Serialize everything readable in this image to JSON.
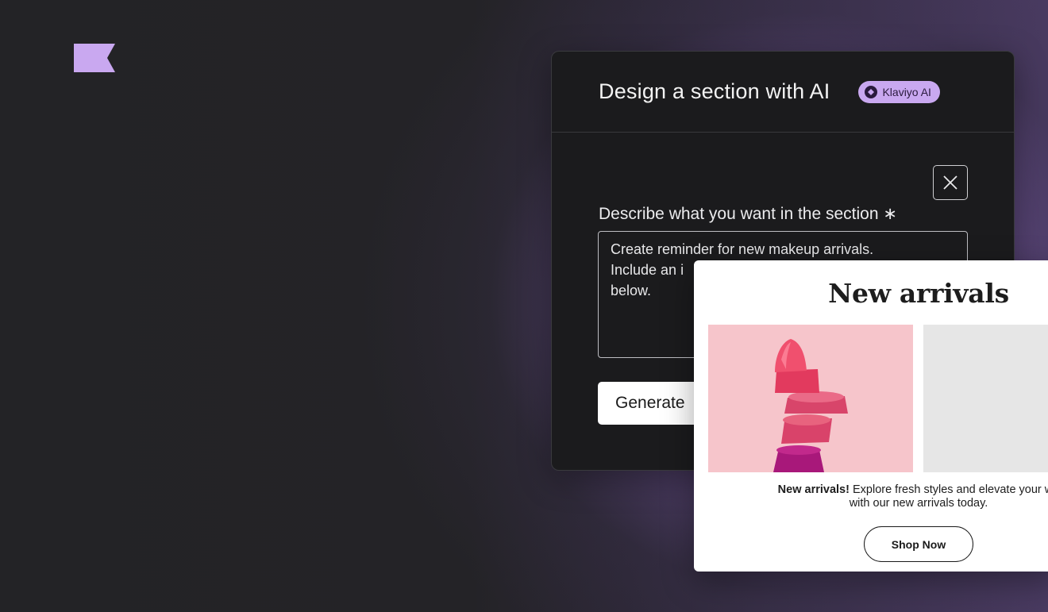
{
  "brand": {
    "logo_icon": "klaviyo-flag-icon",
    "accent_color": "#c9a8f0"
  },
  "ai_panel": {
    "title": "Design a section with AI",
    "badge": {
      "icon": "klaviyo-ai-icon",
      "label": "Klaviyo AI"
    },
    "close_icon": "close-icon",
    "field_label": "Describe what you want in the section ∗",
    "prompt_lines": [
      "Create reminder for new makeup arrivals.",
      "Include an i",
      "below."
    ],
    "generate_label": "Generate"
  },
  "preview": {
    "title": "New arrivals",
    "text_bold": "New arrivals!",
    "text_line1": " Explore fresh styles and elevate your wa",
    "text_line2": "with our new arrivals today.",
    "cta_label": "Shop Now",
    "image_colors": {
      "product_bg": "#f6c5cb",
      "placeholder_bg": "#e6e6e6"
    }
  }
}
